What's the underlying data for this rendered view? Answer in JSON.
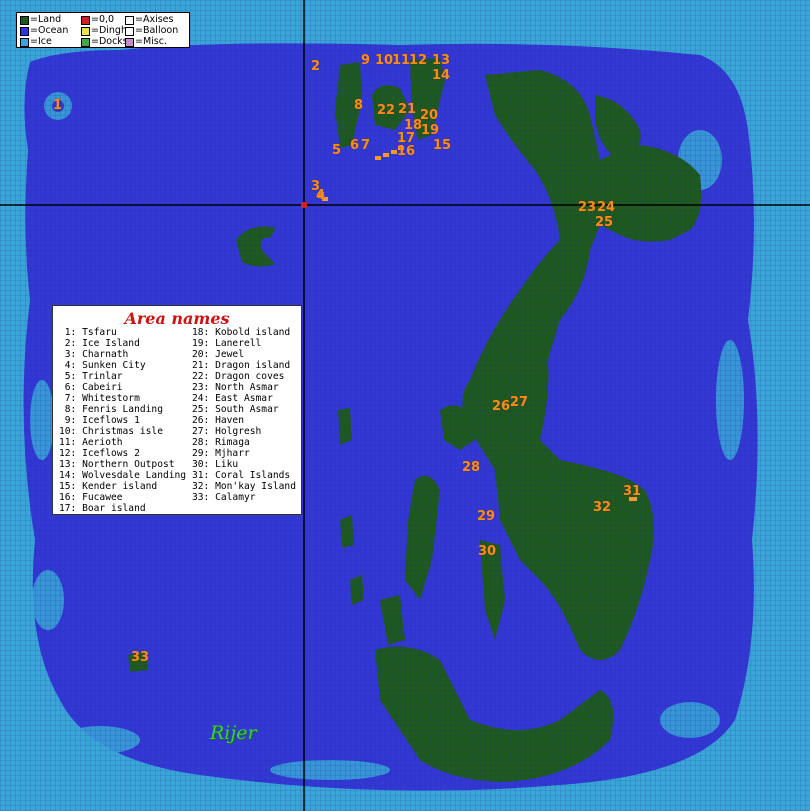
{
  "legend": {
    "items": [
      {
        "label": "=Land",
        "color": "#1e5a1e"
      },
      {
        "label": "=0,0",
        "color": "#cc2222"
      },
      {
        "label": "=Axises",
        "color": "#000000"
      },
      {
        "label": "=Ocean",
        "color": "#3338d4"
      },
      {
        "label": "=Dinghy",
        "color": "#f0e040"
      },
      {
        "label": "=Balloon",
        "color": "#ffffff"
      },
      {
        "label": "=Ice",
        "color": "#3aa6d8"
      },
      {
        "label": "=Docks",
        "color": "#44aa44"
      },
      {
        "label": "=Misc.",
        "color": "#cc88cc"
      }
    ]
  },
  "area_names": {
    "title": "Area names",
    "left": [
      " 1: Tsfaru",
      " 2: Ice Island",
      " 3: Charnath",
      " 4: Sunken City",
      " 5: Trinlar",
      " 6: Cabeiri",
      " 7: Whitestorm",
      " 8: Fenris Landing",
      " 9: Iceflows 1",
      "10: Christmas isle",
      "11: Aerioth",
      "12: Iceflows 2",
      "13: Northern Outpost",
      "14: Wolvesdale Landing",
      "15: Kender island",
      "16: Fucawee",
      "17: Boar island"
    ],
    "right": [
      "18: Kobold island",
      "19: Lanerell",
      "20: Jewel",
      "21: Dragon island",
      "22: Dragon coves",
      "23: North Asmar",
      "24: East Asmar",
      "25: South Asmar",
      "26: Haven",
      "27: Holgresh",
      "28: Rimaga",
      "29: Mjharr",
      "30: Liku",
      "31: Coral Islands",
      "32: Mon'kay Island",
      "33: Calamyr"
    ]
  },
  "world_name": "Rijer",
  "markers": [
    {
      "label": "1"
    },
    {
      "label": "2"
    },
    {
      "label": "3"
    },
    {
      "label": "4"
    },
    {
      "label": "5"
    },
    {
      "label": "6"
    },
    {
      "label": "7"
    },
    {
      "label": "8"
    },
    {
      "label": "9"
    },
    {
      "label": "10"
    },
    {
      "label": "11"
    },
    {
      "label": "12"
    },
    {
      "label": "13"
    },
    {
      "label": "14"
    },
    {
      "label": "15"
    },
    {
      "label": "16"
    },
    {
      "label": "17"
    },
    {
      "label": "18"
    },
    {
      "label": "19"
    },
    {
      "label": "20"
    },
    {
      "label": "21"
    },
    {
      "label": "22"
    },
    {
      "label": "23"
    },
    {
      "label": "24"
    },
    {
      "label": "25"
    },
    {
      "label": "26"
    },
    {
      "label": "27"
    },
    {
      "label": "28"
    },
    {
      "label": "29"
    },
    {
      "label": "30"
    },
    {
      "label": "31"
    },
    {
      "label": "32"
    },
    {
      "label": "33"
    }
  ],
  "colors": {
    "ice": "#3aa6d8",
    "ocean": "#3338d4",
    "land": "#1e5a1e",
    "grid": "#1a2a8a",
    "axis": "#000000",
    "origin": "#cc2222"
  }
}
